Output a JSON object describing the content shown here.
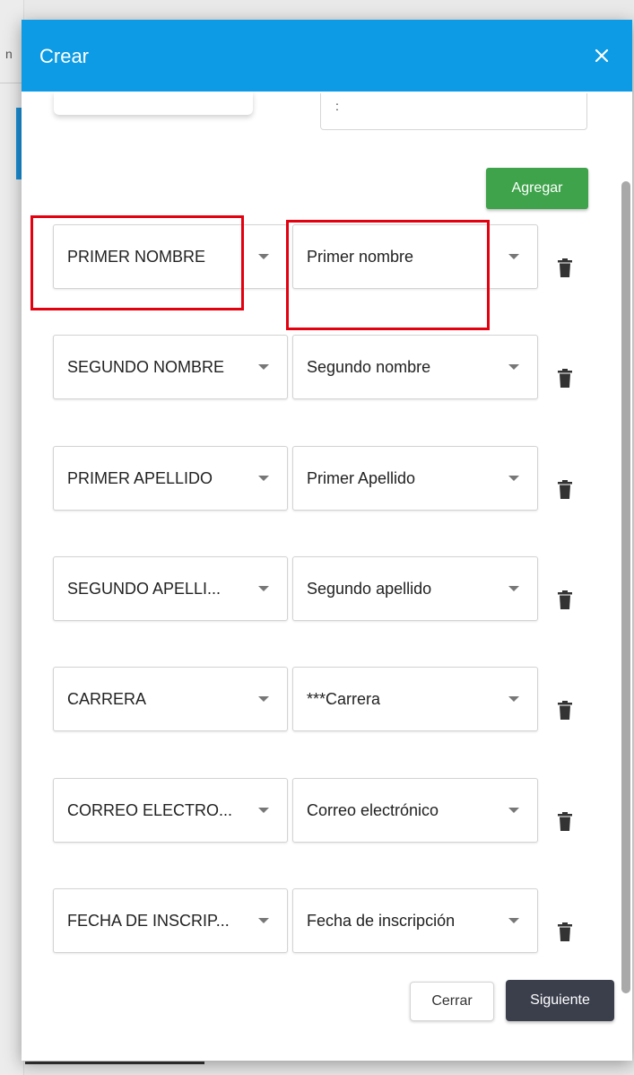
{
  "dialog": {
    "title": "Crear",
    "add_label": "Agregar",
    "close_label": "Cerrar",
    "next_label": "Siguiente",
    "top_input_value": ":"
  },
  "mappings": [
    {
      "source": "PRIMER NOMBRE",
      "target": "Primer nombre"
    },
    {
      "source": "SEGUNDO NOMBRE",
      "target": "Segundo nombre"
    },
    {
      "source": "PRIMER APELLIDO",
      "target": "Primer Apellido"
    },
    {
      "source": "SEGUNDO APELLI...",
      "target": "Segundo apellido"
    },
    {
      "source": "CARRERA",
      "target": "***Carrera"
    },
    {
      "source": "CORREO ELECTRO...",
      "target": "Correo electrónico"
    },
    {
      "source": "FECHA DE INSCRIP...",
      "target": "Fecha de inscripción"
    }
  ],
  "colors": {
    "header": "#0c9be4",
    "add_button": "#3ea34a",
    "next_button": "#3b3f4c",
    "highlight": "#e3000f"
  },
  "icons": {
    "close": "close-icon",
    "row_action": "trash-icon",
    "dropdown": "chevron-down-icon"
  }
}
